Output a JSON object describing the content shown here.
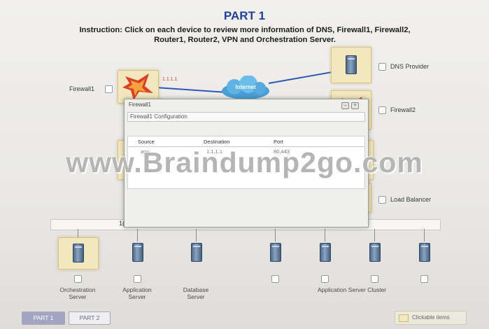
{
  "header": {
    "title": "PART 1",
    "instruction": "Instruction: Click on each device to review more information of DNS, Firewall1, Firewall2,",
    "instruction_line2": "Router1, Router2, VPN and Orchestration Server."
  },
  "devices": {
    "firewall1_label": "Firewall1",
    "firewall1_ip": "1.1.1.1",
    "firewall2_label": "Firewall2",
    "dns_label": "DNS Provider",
    "internet_label": "Internet",
    "load_balancer_label": "Load Balancer"
  },
  "popup": {
    "title": "Firewall1",
    "section_title": "Firewall1 Configuration",
    "columns": [
      "Source",
      "Destination",
      "Port"
    ],
    "rows": [
      [
        "any",
        "1.1.1.1",
        "80,443"
      ]
    ]
  },
  "bus": {
    "left_label": "1(",
    "right_label": ".4"
  },
  "bottom_devices": [
    {
      "label_1": "Orchestration",
      "label_2": "Server"
    },
    {
      "label_1": "Application",
      "label_2": "Server"
    },
    {
      "label_1": "Database",
      "label_2": "Server"
    },
    {
      "label_1": "Application Server Cluster",
      "label_2": ""
    }
  ],
  "watermark": "www.Braindump2go.com",
  "tabs": [
    "PART 1",
    "PART 2"
  ],
  "legend": {
    "label": "Clickable items"
  },
  "colors": {
    "title": "#23409a",
    "link_line": "#2d57b3",
    "clickable_tile": "#f3e7bf",
    "active_tab": "#a3a4c4",
    "firewall_red": "#d9412a"
  }
}
